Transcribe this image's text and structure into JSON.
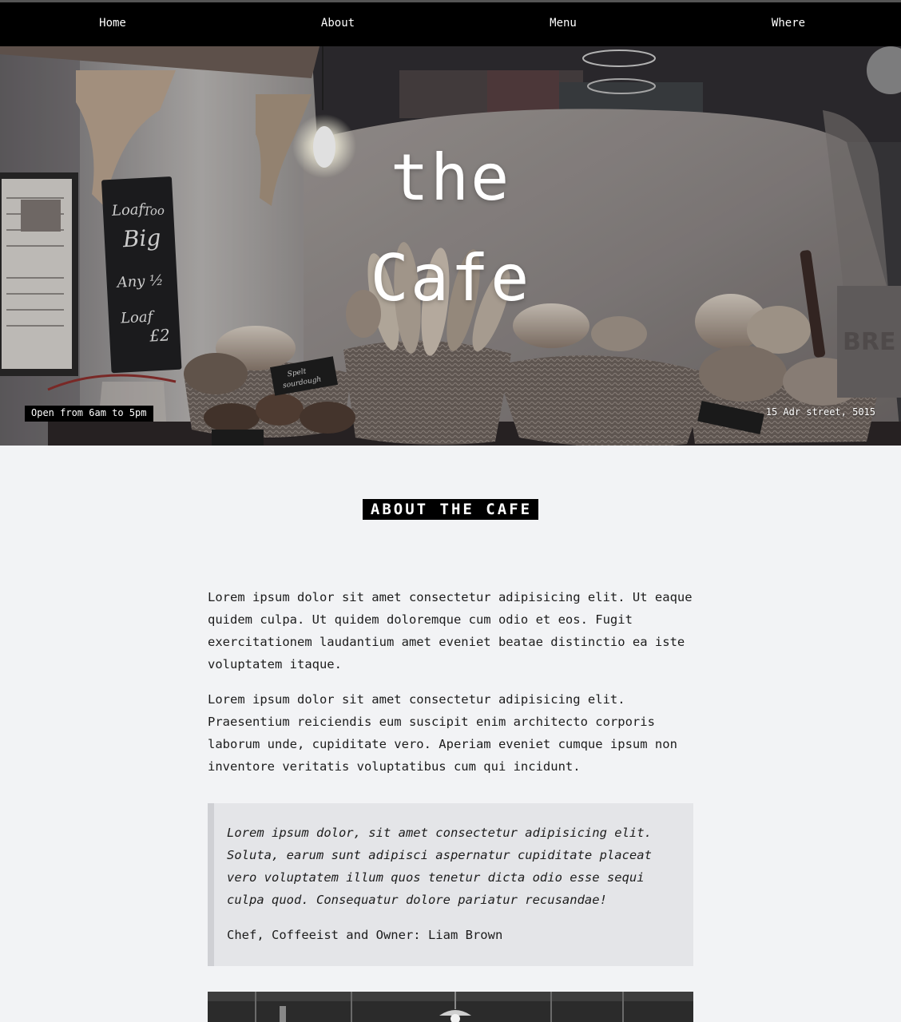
{
  "nav": {
    "items": [
      {
        "label": "Home"
      },
      {
        "label": "About"
      },
      {
        "label": "Menu"
      },
      {
        "label": "Where"
      }
    ]
  },
  "hero": {
    "title_line1": "the",
    "title_line2": "Cafe",
    "hours": "Open from 6am to 5pm",
    "address": "15 Adr street, 5015",
    "image_signs": {
      "chalkboard": [
        "Loaf Too",
        "Big",
        "Any 1/2",
        "Loaf £2"
      ],
      "tag": [
        "Spelt",
        "sourdough"
      ],
      "wall_text": "BRE"
    }
  },
  "about": {
    "heading": "ABOUT THE CAFE",
    "paragraphs": [
      "Lorem ipsum dolor sit amet consectetur adipisicing elit. Ut eaque quidem culpa. Ut quidem doloremque cum odio et eos. Fugit exercitationem laudantium amet eveniet beatae distinctio ea iste voluptatem itaque.",
      "Lorem ipsum dolor sit amet consectetur adipisicing elit. Praesentium reiciendis eum suscipit enim architecto corporis laborum unde, cupiditate vero. Aperiam eveniet cumque ipsum non inventore veritatis voluptatibus cum qui incidunt."
    ],
    "quote": "Lorem ipsum dolor, sit amet consectetur adipisicing elit. Soluta, earum sunt adipisci aspernatur cupiditate placeat vero voluptatem illum quos tenetur dicta odio esse sequi culpa quod. Consequatur dolore pariatur recusandae!",
    "quote_author": "Chef, Coffeeist and Owner: Liam Brown"
  }
}
